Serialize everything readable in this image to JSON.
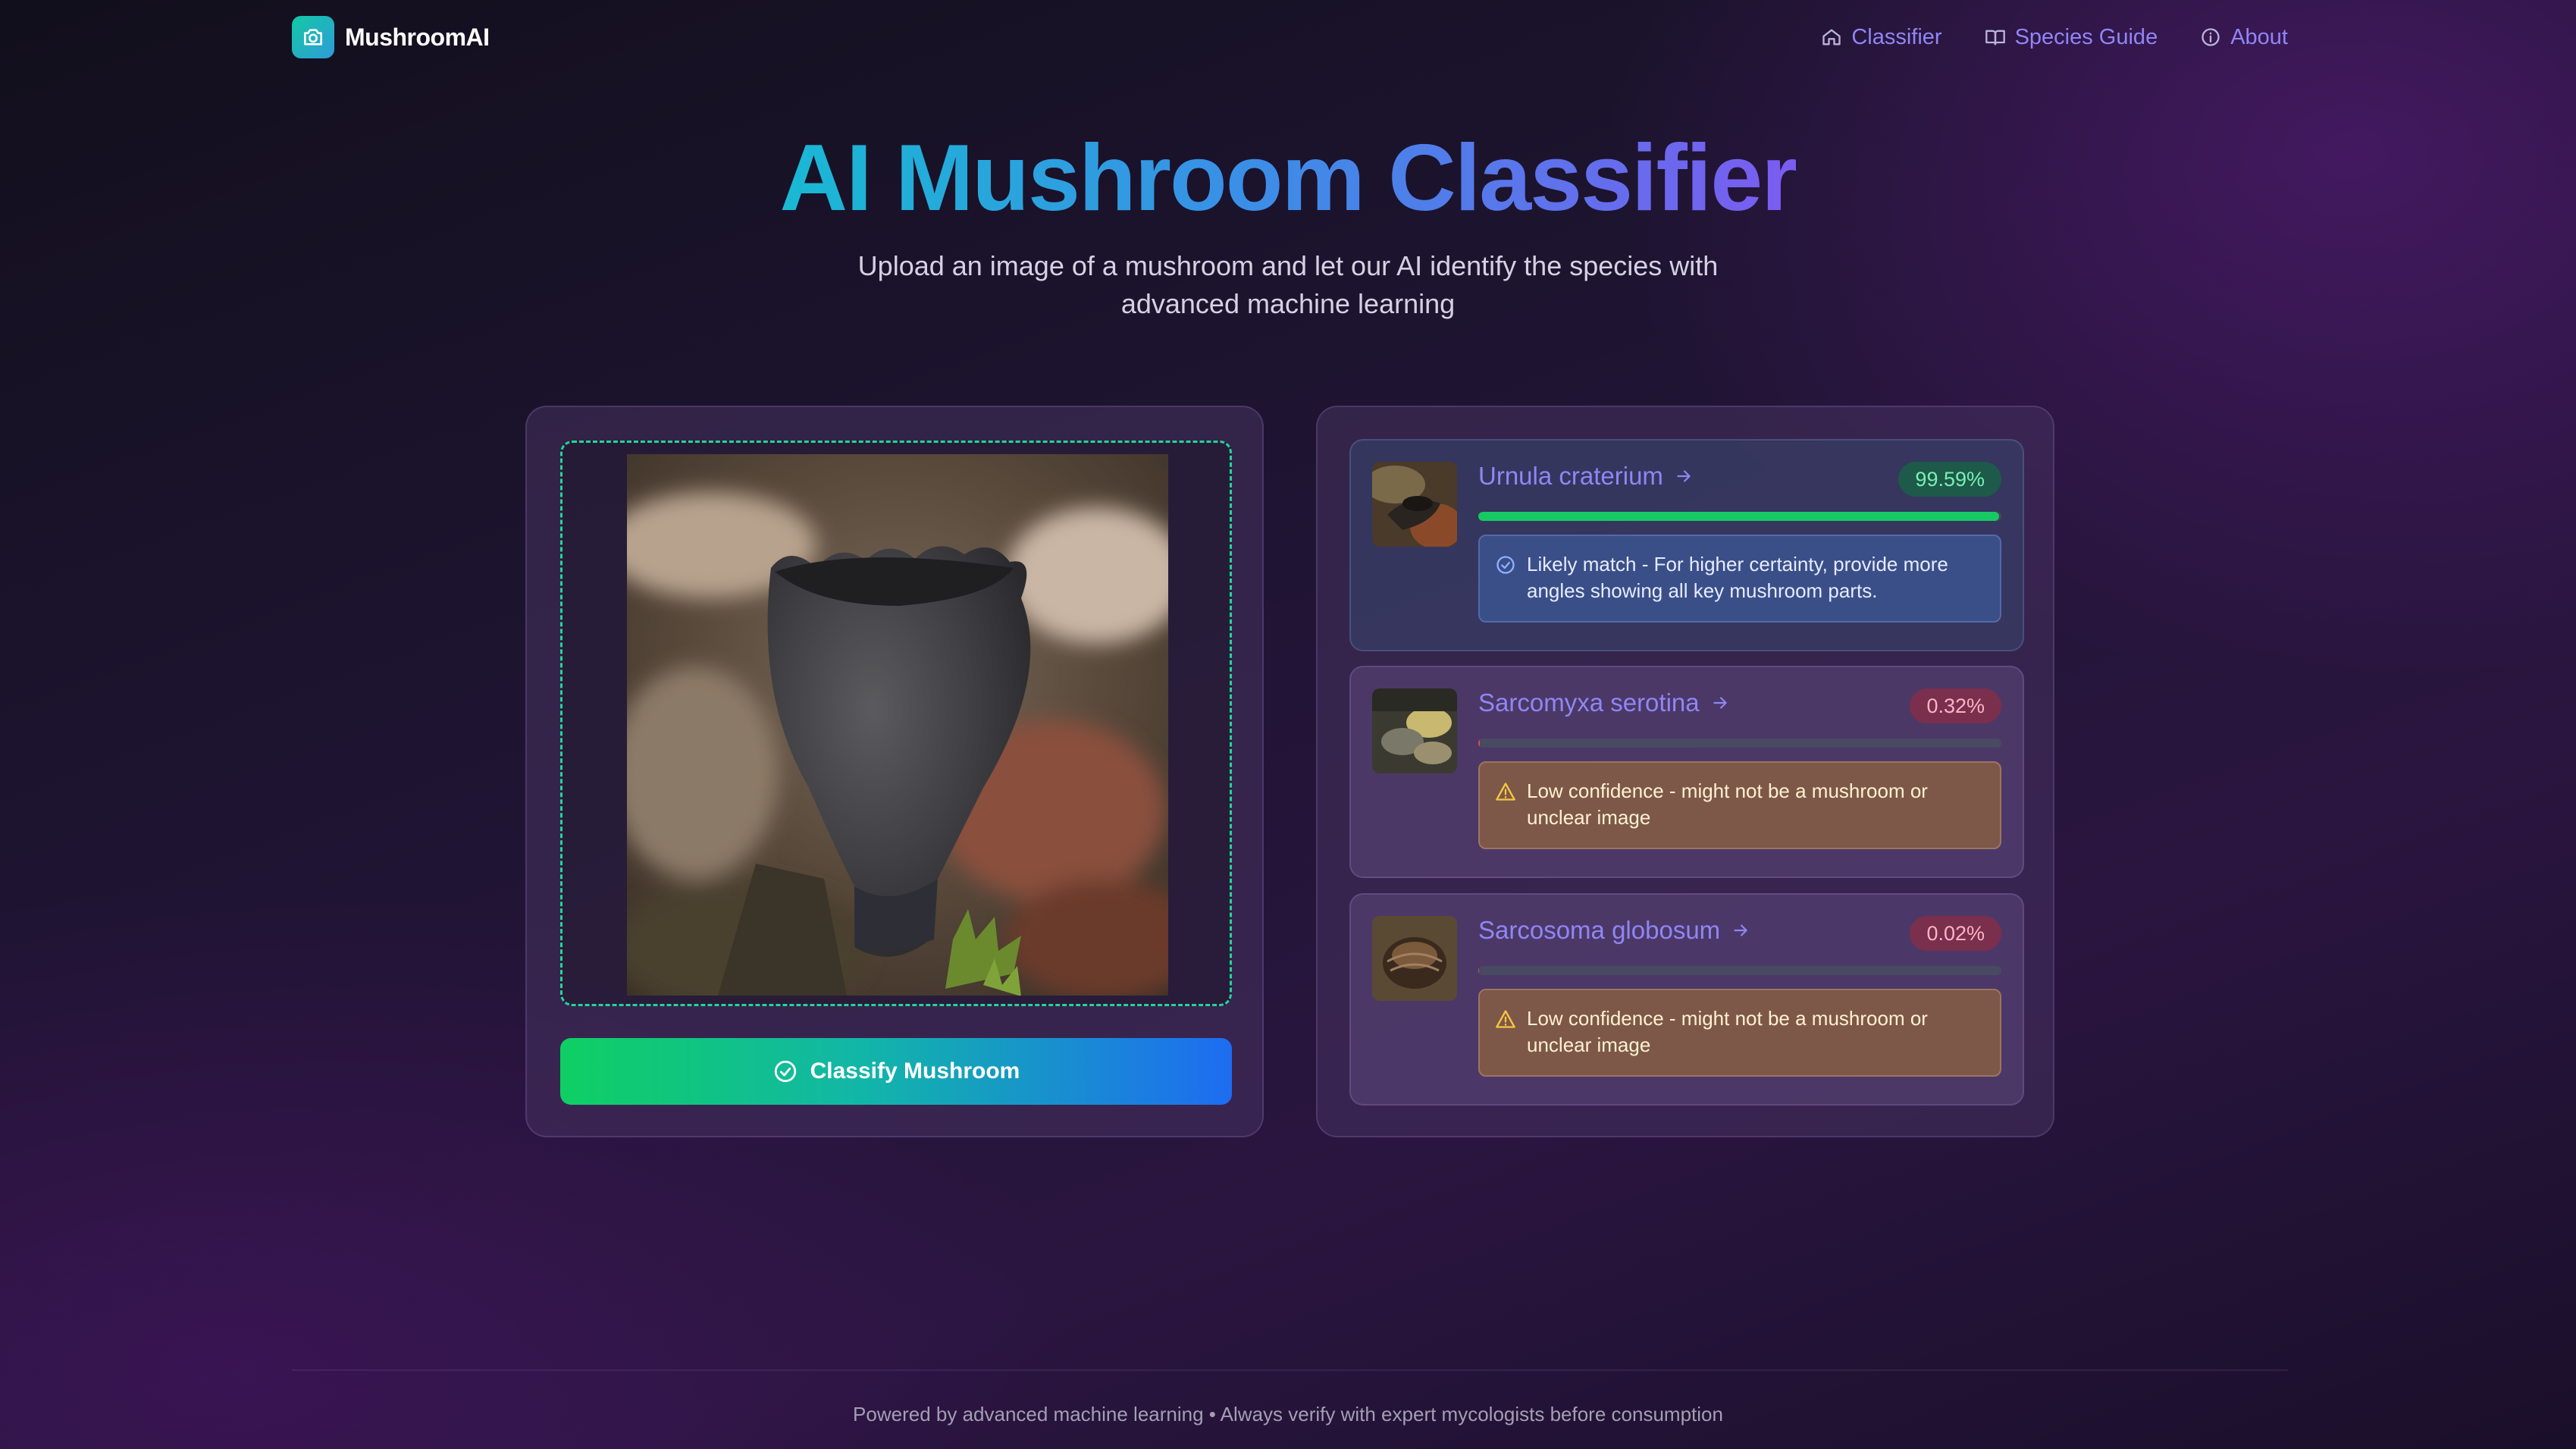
{
  "brand": {
    "name": "MushroomAI",
    "logo_icon": "camera-icon"
  },
  "nav": {
    "links": [
      {
        "label": "Classifier",
        "icon": "home-icon"
      },
      {
        "label": "Species Guide",
        "icon": "book-icon"
      },
      {
        "label": "About",
        "icon": "info-icon"
      }
    ]
  },
  "hero": {
    "title": "AI Mushroom Classifier",
    "subtitle": "Upload an image of a mushroom and let our AI identify the species with advanced machine learning"
  },
  "upload": {
    "image_alt": "Uploaded mushroom photo",
    "classify_label": "Classify Mushroom"
  },
  "results": [
    {
      "species": "Urnula craterium",
      "confidence_label": "99.59%",
      "confidence": 99.59,
      "level": "high",
      "note": "Likely match - For higher certainty, provide more angles showing all key mushroom parts."
    },
    {
      "species": "Sarcomyxa serotina",
      "confidence_label": "0.32%",
      "confidence": 0.32,
      "level": "low",
      "note": "Low confidence - might not be a mushroom or unclear image"
    },
    {
      "species": "Sarcosoma globosum",
      "confidence_label": "0.02%",
      "confidence": 0.02,
      "level": "low",
      "note": "Low confidence - might not be a mushroom or unclear image"
    }
  ],
  "footer": {
    "text": "Powered by advanced machine learning • Always verify with expert mycologists before consumption"
  },
  "colors": {
    "accent": "#8f86f5",
    "success": "#17c964",
    "danger": "#ef4453",
    "button_gradient_start": "#0fcf63",
    "button_gradient_end": "#1e6cf2"
  }
}
